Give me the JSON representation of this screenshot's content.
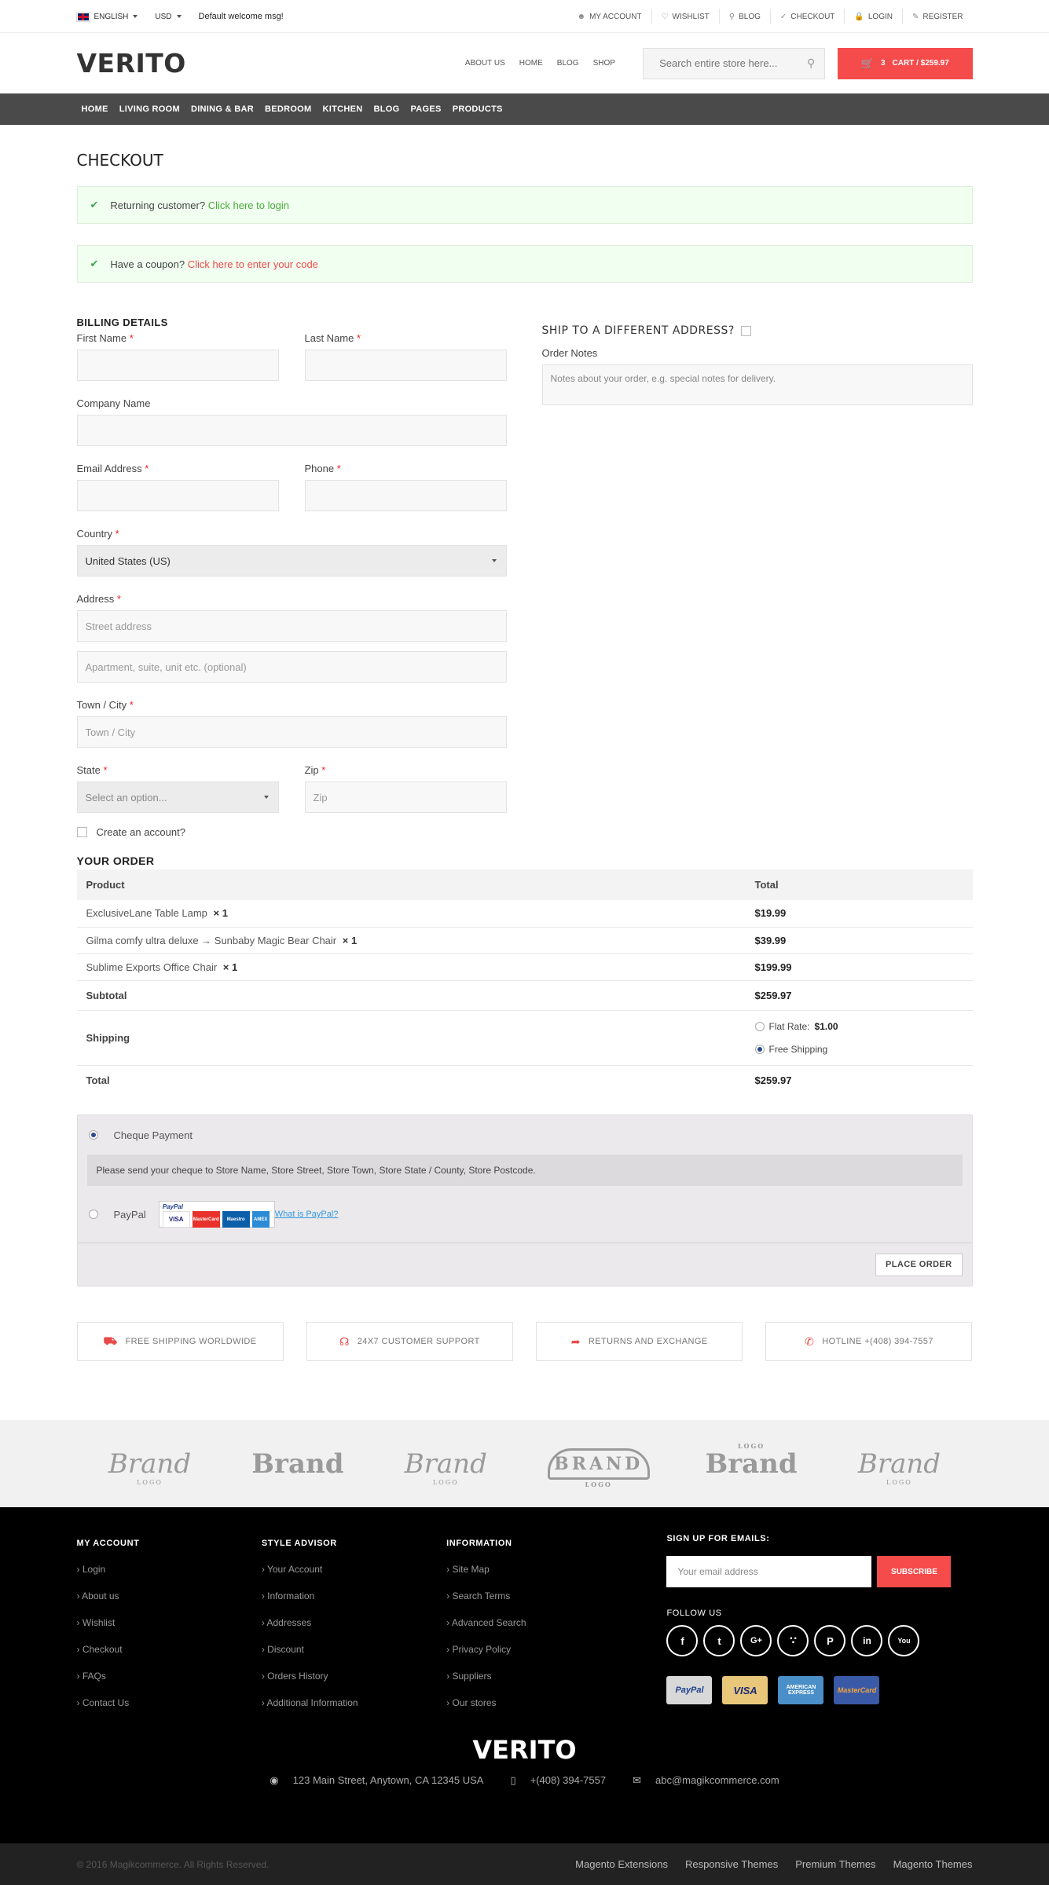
{
  "topbar": {
    "language": "ENGLISH",
    "currency": "USD",
    "welcome": "Default welcome msg!",
    "links": [
      "MY ACCOUNT",
      "WISHLIST",
      "BLOG",
      "CHECKOUT",
      "LOGIN",
      "REGISTER"
    ]
  },
  "header": {
    "logo": "VERITO",
    "nav": [
      "ABOUT US",
      "HOME",
      "BLOG",
      "SHOP"
    ],
    "search_placeholder": "Search entire store here...",
    "cart_count": "3",
    "cart_label": "CART / $259.97"
  },
  "mainnav": [
    "HOME",
    "LIVING ROOM",
    "DINING & BAR",
    "BEDROOM",
    "KITCHEN",
    "BLOG",
    "PAGES",
    "PRODUCTS"
  ],
  "page": {
    "title": "CHECKOUT",
    "returning_text": "Returning customer?",
    "returning_link": "Click here to login",
    "coupon_text": "Have a coupon?",
    "coupon_link": "Click here to enter your code"
  },
  "billing": {
    "heading": "BILLING DETAILS",
    "first_name": "First Name",
    "last_name": "Last Name",
    "company": "Company Name",
    "email": "Email Address",
    "phone": "Phone",
    "country": "Country",
    "country_value": "United States (US)",
    "address": "Address",
    "street_placeholder": "Street address",
    "apt_placeholder": "Apartment, suite, unit etc. (optional)",
    "town": "Town / City",
    "town_placeholder": "Town / City",
    "state": "State",
    "state_placeholder": "Select an option...",
    "zip": "Zip",
    "zip_placeholder": "Zip",
    "create_account": "Create an account?",
    "required_mark": "*"
  },
  "shipping": {
    "heading": "SHIP TO A DIFFERENT ADDRESS?",
    "notes_label": "Order Notes",
    "notes_placeholder": "Notes about your order, e.g. special notes for delivery."
  },
  "order": {
    "heading": "YOUR ORDER",
    "col_product": "Product",
    "col_total": "Total",
    "items": [
      {
        "name": "ExclusiveLane Table Lamp",
        "qty": "× 1",
        "total": "$19.99"
      },
      {
        "name": "Gilma comfy ultra deluxe → Sunbaby Magic Bear Chair",
        "qty": "× 1",
        "total": "$39.99"
      },
      {
        "name": "Sublime Exports Office Chair",
        "qty": "× 1",
        "total": "$199.99"
      }
    ],
    "subtotal_label": "Subtotal",
    "subtotal": "$259.97",
    "shipping_label": "Shipping",
    "flat_rate_label": "Flat Rate:",
    "flat_rate_value": "$1.00",
    "free_shipping": "Free Shipping",
    "total_label": "Total",
    "total": "$259.97"
  },
  "payment": {
    "cheque_label": "Cheque Payment",
    "cheque_info": "Please send your cheque to Store Name, Store Street, Store Town, Store State / County, Store Postcode.",
    "paypal_label": "PayPal",
    "paypal_logo": "PayPal",
    "what_is_paypal": "What is PayPal?",
    "place_order": "PLACE ORDER",
    "card_labels": [
      "VISA",
      "MasterCard",
      "Maestro",
      "AMEX"
    ]
  },
  "features": [
    "FREE SHIPPING WORLDWIDE",
    "24X7 CUSTOMER SUPPORT",
    "RETURNS AND EXCHANGE",
    "HOTLINE +(408) 394-7557"
  ],
  "brands": [
    {
      "name": "Brand",
      "sub": "LOGO"
    },
    {
      "name": "Brand",
      "sub": ""
    },
    {
      "name": "Brand",
      "sub": "LOGO"
    },
    {
      "name": "BRAND",
      "sub": "LOGO"
    },
    {
      "name": "Brand",
      "sub": "LOGO"
    },
    {
      "name": "Brand",
      "sub": "LOGO"
    }
  ],
  "footer": {
    "col1": {
      "title": "MY ACCOUNT",
      "links": [
        "Login",
        "About us",
        "Wishlist",
        "Checkout",
        "FAQs",
        "Contact Us"
      ]
    },
    "col2": {
      "title": "STYLE ADVISOR",
      "links": [
        "Your Account",
        "Information",
        "Addresses",
        "Discount",
        "Orders History",
        "Additional Information"
      ]
    },
    "col3": {
      "title": "INFORMATION",
      "links": [
        "Site Map",
        "Search Terms",
        "Advanced Search",
        "Privacy Policy",
        "Suppliers",
        "Our stores"
      ]
    },
    "signup_title": "SIGN UP FOR EMAILS:",
    "email_placeholder": "Your email address",
    "subscribe": "SUBSCRIBE",
    "follow_title": "FOLLOW US",
    "pay_cards": [
      "PayPal",
      "VISA",
      "AMERICAN EXPRESS",
      "MasterCard"
    ],
    "logo": "VERITO",
    "address": "123 Main Street, Anytown, CA 12345 USA",
    "phone": "+(408) 394-7557",
    "email": "abc@magikcommerce.com",
    "copyright": "© 2016 Magikcommerce. All Rights Reserved.",
    "bottom_links": [
      "Magento Extensions",
      "Responsive Themes",
      "Premium Themes",
      "Magento Themes"
    ]
  }
}
